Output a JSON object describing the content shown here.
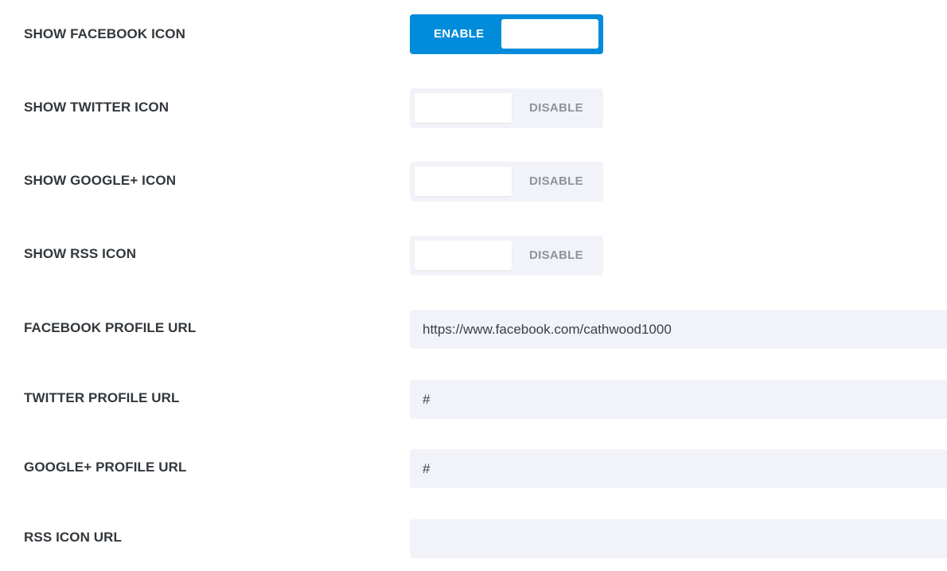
{
  "settings": {
    "facebook_icon": {
      "label": "SHOW FACEBOOK ICON",
      "state_label": "ENABLE",
      "enabled": true
    },
    "twitter_icon": {
      "label": "SHOW TWITTER ICON",
      "state_label": "DISABLE",
      "enabled": false
    },
    "google_icon": {
      "label": "SHOW GOOGLE+ ICON",
      "state_label": "DISABLE",
      "enabled": false
    },
    "rss_icon": {
      "label": "SHOW RSS ICON",
      "state_label": "DISABLE",
      "enabled": false
    },
    "facebook_url": {
      "label": "FACEBOOK PROFILE URL",
      "value": "https://www.facebook.com/cathwood1000"
    },
    "twitter_url": {
      "label": "TWITTER PROFILE URL",
      "value": "#"
    },
    "google_url": {
      "label": "GOOGLE+ PROFILE URL",
      "value": "#"
    },
    "rss_url": {
      "label": "RSS ICON URL",
      "value": ""
    }
  },
  "colors": {
    "accent": "#008bdb",
    "field_background": "#f1f3f8",
    "label_text": "#32373c",
    "disabled_text": "#8d949e"
  }
}
